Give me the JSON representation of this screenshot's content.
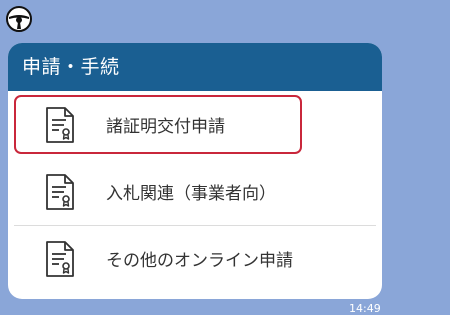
{
  "card": {
    "header_title": "申請・手続"
  },
  "menu": [
    {
      "label": "諸証明交付申請",
      "icon": "document-certificate-icon"
    },
    {
      "label": "入札関連（事業者向）",
      "icon": "document-certificate-icon"
    },
    {
      "label": "その他のオンライン申請",
      "icon": "document-certificate-icon"
    }
  ],
  "message": {
    "time": "14:49"
  },
  "colors": {
    "background": "#8aa6d8",
    "header": "#1a5f92",
    "selection_border": "#c9273b"
  }
}
